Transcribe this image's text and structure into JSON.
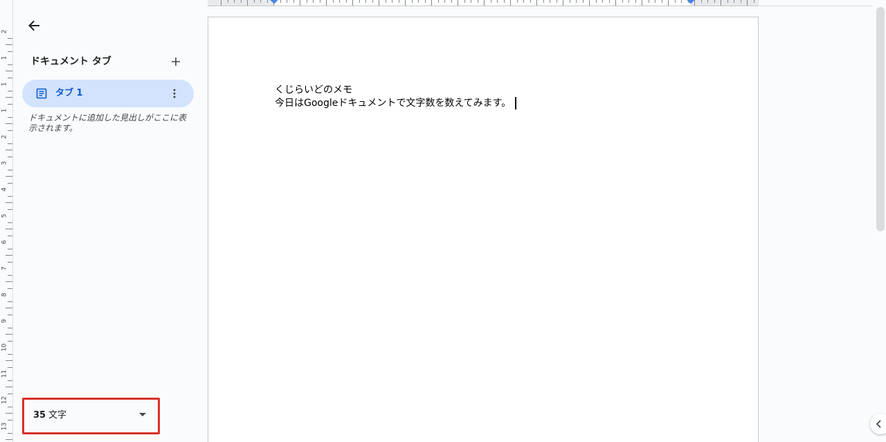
{
  "sidebar": {
    "tabs_title": "ドキュメント タブ",
    "add_tab_symbol": "+",
    "tab_item_label": "タブ 1",
    "outline_hint": "ドキュメントに追加した見出しがここに表示されます。"
  },
  "word_count": {
    "value": "35",
    "unit": "文字"
  },
  "document": {
    "lines": [
      "くじらいどのメモ",
      "今日はGoogleドキュメントで文字数を数えてみます。"
    ]
  },
  "ruler": {
    "vertical_labels": [
      "2",
      "1",
      "1",
      "1",
      "2",
      "3",
      "4",
      "5",
      "6",
      "7",
      "8",
      "9",
      "10",
      "11",
      "12",
      "13"
    ]
  },
  "colors": {
    "highlight_border": "#d93025",
    "tab_active_bg": "#d3e3fd",
    "tab_active_text": "#0b57d0"
  },
  "icons": {
    "back": "arrow-left-icon",
    "add": "plus-icon",
    "tab": "document-icon",
    "more": "more-vert-icon",
    "dropdown": "caret-down-icon",
    "side_toggle": "chevron-left-icon"
  }
}
